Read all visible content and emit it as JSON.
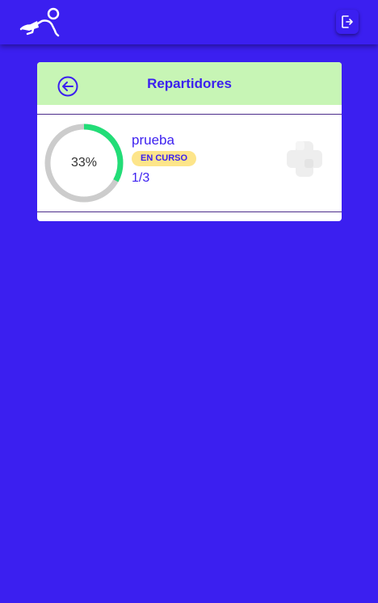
{
  "header": {
    "logo_icon": "running-person-logo-icon",
    "logout_icon": "logout-icon"
  },
  "card": {
    "title": "Repartidores",
    "back_icon": "arrow-left-circle-icon",
    "header_color": "#c7f5b5"
  },
  "repartidores": [
    {
      "name": "prueba",
      "status": "EN CURSO",
      "progress_label": "33%",
      "progress": 0.33,
      "count": "1/3",
      "avatar_icon": "placeholder-image-icon"
    }
  ],
  "colors": {
    "background": "#3b1ff0",
    "progress": "#22dd77",
    "badge": "#fde58a"
  }
}
